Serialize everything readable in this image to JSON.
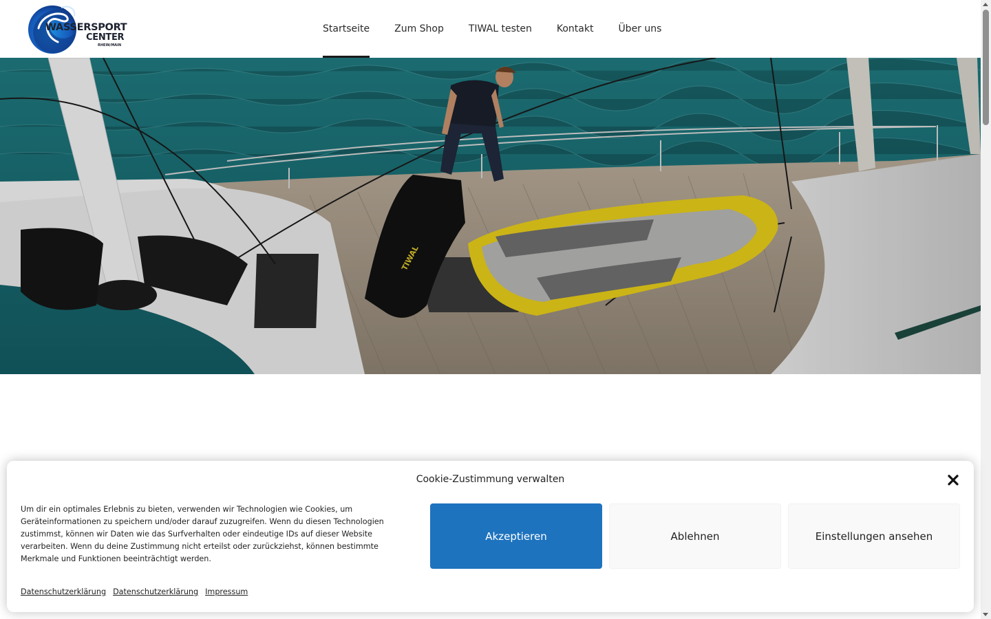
{
  "logo": {
    "line1": "WASSERSPORT",
    "line2": "CENTER",
    "line3": "RHEIN/MAIN"
  },
  "nav": {
    "items": [
      {
        "label": "Startseite",
        "active": true
      },
      {
        "label": "Zum Shop",
        "active": false
      },
      {
        "label": "TIWAL testen",
        "active": false
      },
      {
        "label": "Kontakt",
        "active": false
      },
      {
        "label": "Über uns",
        "active": false
      }
    ]
  },
  "hero": {
    "bag_brand": "TIWAL"
  },
  "cookie": {
    "title": "Cookie-Zustimmung verwalten",
    "text": "Um dir ein optimales Erlebnis zu bieten, verwenden wir Technologien wie Cookies, um Geräteinformationen zu speichern und/oder darauf zuzugreifen. Wenn du diesen Technologien zustimmst, können wir Daten wie das Surfverhalten oder eindeutige IDs auf dieser Website verarbeiten. Wenn du deine Zustimmung nicht erteilst oder zurückziehst, können bestimmte Merkmale und Funktionen beeinträchtigt werden.",
    "accept_label": "Akzeptieren",
    "deny_label": "Ablehnen",
    "settings_label": "Einstellungen ansehen",
    "links": [
      "Datenschutzerklärung",
      "Datenschutzerklärung",
      "Impressum"
    ]
  },
  "colors": {
    "accent": "#1e73be",
    "nav_underline": "#1a1a1a",
    "button_neutral": "#f9f9f9"
  },
  "icons": {
    "close": "close-icon",
    "logo": "wave-logo-icon"
  }
}
